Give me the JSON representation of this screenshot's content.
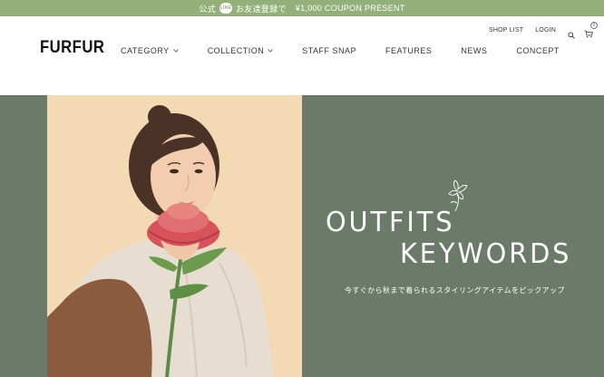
{
  "banner": {
    "prefix": "公式",
    "line_badge": "LINE",
    "middle": "お友達登録で",
    "coupon": "¥1,000 COUPON PRESENT",
    "color": "#94b07a"
  },
  "header": {
    "logo": "FURFUR",
    "util_links": {
      "shop_list": "SHOP LIST",
      "login": "LOGIN"
    },
    "cart_count": "0",
    "icons": [
      "search-icon",
      "cart-icon"
    ],
    "nav": [
      {
        "label": "CATEGORY",
        "dropdown": true
      },
      {
        "label": "COLLECTION",
        "dropdown": true
      },
      {
        "label": "STAFF SNAP",
        "dropdown": false
      },
      {
        "label": "FEATURES",
        "dropdown": false
      },
      {
        "label": "NEWS",
        "dropdown": false
      },
      {
        "label": "CONCEPT",
        "dropdown": false
      }
    ]
  },
  "hero": {
    "title_line1": "OUTFITS",
    "title_line2": "KEYWORDS",
    "subtitle": "今すぐから秋まで着られるスタイリングアイテムをピックアップ",
    "background": "#6b7a69",
    "photo_background": "#f4d9b5",
    "doodle_icon": "flower-doodle-icon"
  }
}
